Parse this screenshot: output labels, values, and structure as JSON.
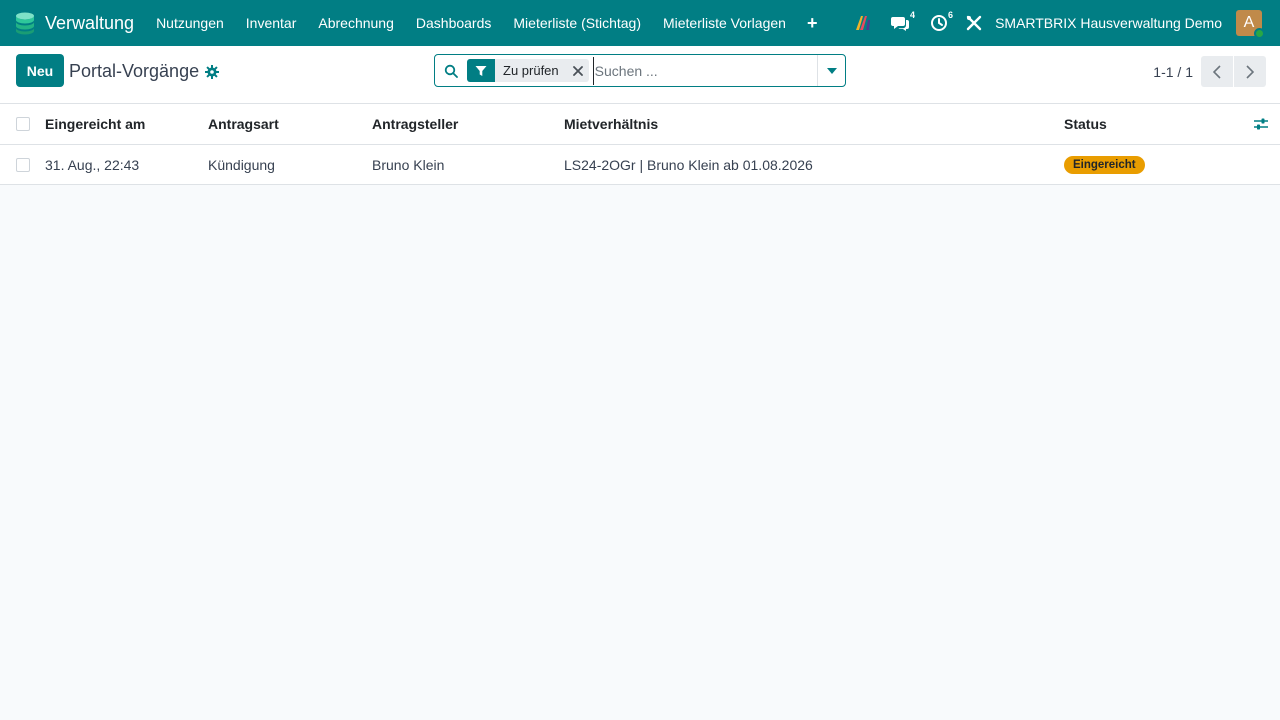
{
  "app": {
    "title": "Verwaltung",
    "accent": "#017e84"
  },
  "nav": {
    "items": [
      {
        "label": "Nutzungen"
      },
      {
        "label": "Inventar"
      },
      {
        "label": "Abrechnung"
      },
      {
        "label": "Dashboards"
      },
      {
        "label": "Mieterliste (Stichtag)"
      },
      {
        "label": "Mieterliste Vorlagen"
      }
    ],
    "plus": "+"
  },
  "systray": {
    "messages_count": "4",
    "activities_count": "6",
    "company": "SMARTBRIX Hausverwaltung Demo",
    "avatar_letter": "A"
  },
  "control": {
    "new_label": "Neu",
    "title": "Portal-Vorgänge",
    "search": {
      "facet_label": "Zu prüfen",
      "placeholder": "Suchen ..."
    },
    "pager": "1-1 / 1"
  },
  "list": {
    "columns": [
      "Eingereicht am",
      "Antragsart",
      "Antragsteller",
      "Mietverhältnis",
      "Status"
    ],
    "rows": [
      {
        "eingereicht": "31. Aug., 22:43",
        "antragsart": "Kündigung",
        "antragsteller": "Bruno Klein",
        "mietverhaeltnis": "LS24-2OGr | Bruno Klein ab 01.08.2026",
        "status": "Eingereicht",
        "status_color": "#e99d00"
      }
    ]
  }
}
